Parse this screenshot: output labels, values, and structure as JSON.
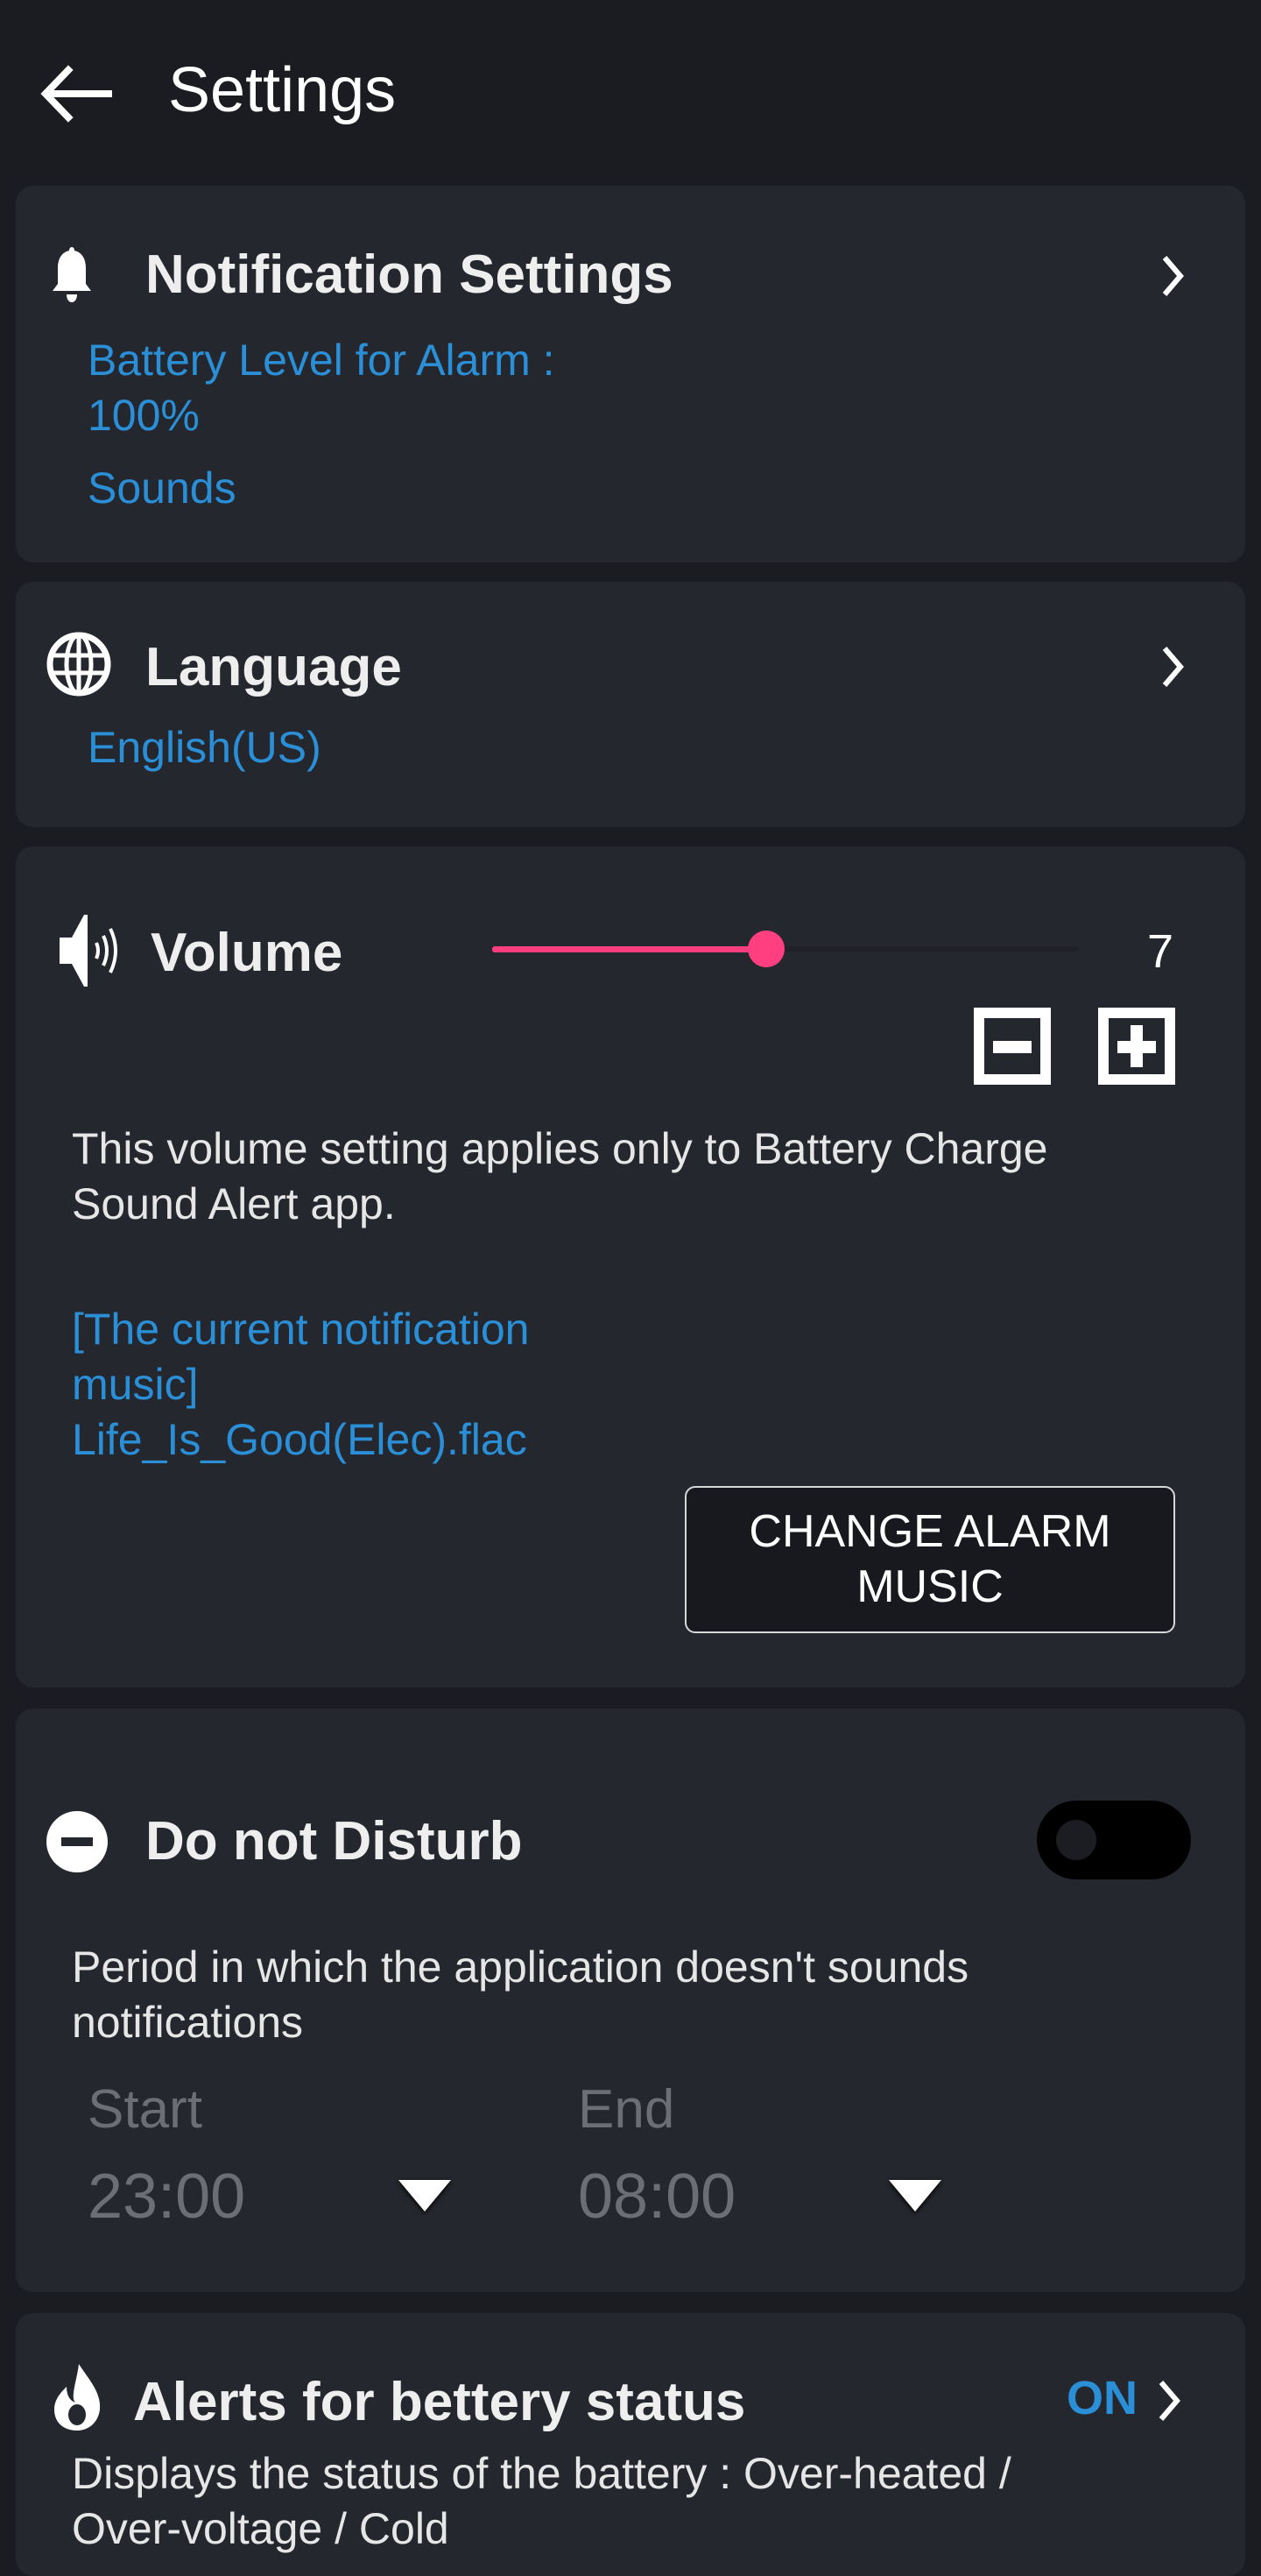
{
  "appbar": {
    "title": "Settings",
    "back_icon": "arrow-left-icon"
  },
  "notification": {
    "title": "Notification Settings",
    "icon": "bell-icon",
    "battery_level_label": "Battery Level for Alarm :",
    "battery_level_value": "100%",
    "sounds_label": "Sounds"
  },
  "language": {
    "title": "Language",
    "icon": "globe-icon",
    "value": "English(US)"
  },
  "volume": {
    "title": "Volume",
    "icon": "speaker-icon",
    "value": 7,
    "max": 15,
    "value_label": "7",
    "description_line1": "This volume setting applies only to Battery Charge",
    "description_line2": "Sound Alert app.",
    "current_music_line1": "[The current notification",
    "current_music_line2": "music]",
    "current_music_file": "Life_Is_Good(Elec).flac",
    "change_button_line1": "CHANGE ALARM",
    "change_button_line2": "MUSIC",
    "colors": {
      "slider_accent": "#ff3f7f"
    }
  },
  "dnd": {
    "title": "Do not Disturb",
    "icon": "minus-circle-icon",
    "enabled": false,
    "description_line1": "Period in which the application doesn't sounds",
    "description_line2": "notifications",
    "start_label": "Start",
    "start_value": "23:00",
    "end_label": "End",
    "end_value": "08:00"
  },
  "battery_alerts": {
    "title": "Alerts for bettery status",
    "icon": "flame-icon",
    "status": "ON",
    "description_line1": "Displays the status of the battery : Over-heated /",
    "description_line2": "Over-voltage / Cold"
  },
  "colors": {
    "accent_blue": "#2a8fd6",
    "background": "#1a1c22",
    "card": "#25272e"
  }
}
